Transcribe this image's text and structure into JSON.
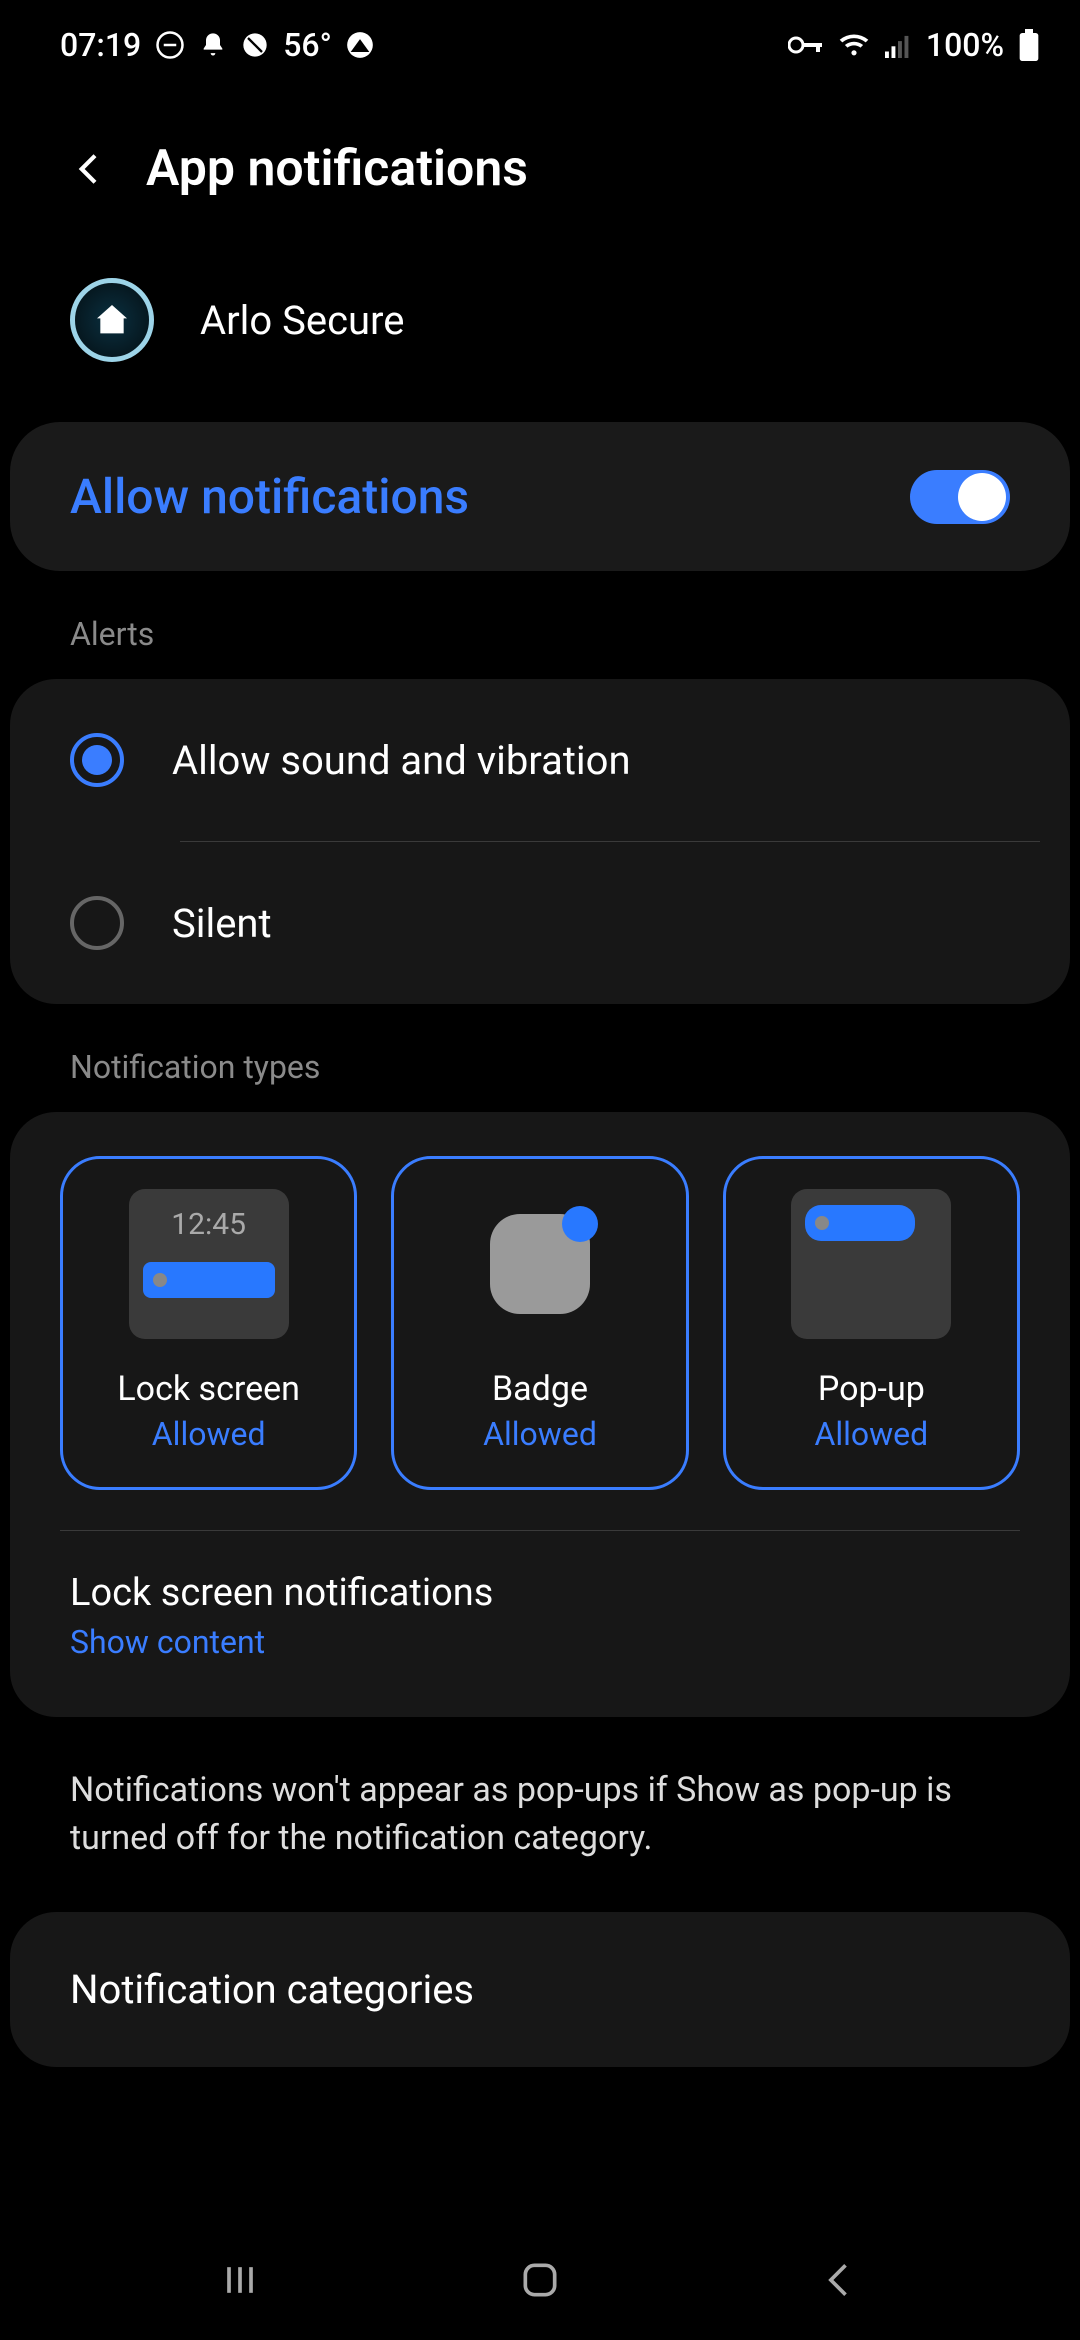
{
  "status": {
    "time": "07:19",
    "temp": "56°",
    "battery": "100%"
  },
  "header": {
    "title": "App notifications"
  },
  "app": {
    "name": "Arlo Secure"
  },
  "allow": {
    "label": "Allow notifications",
    "enabled": true
  },
  "sections": {
    "alerts": "Alerts",
    "types": "Notification types"
  },
  "alerts": {
    "options": [
      {
        "label": "Allow sound and vibration",
        "selected": true
      },
      {
        "label": "Silent",
        "selected": false
      }
    ]
  },
  "types": {
    "lock": {
      "label": "Lock screen",
      "status": "Allowed",
      "preview_time": "12:45"
    },
    "badge": {
      "label": "Badge",
      "status": "Allowed"
    },
    "popup": {
      "label": "Pop-up",
      "status": "Allowed"
    }
  },
  "lock_notif": {
    "title": "Lock screen notifications",
    "sub": "Show content"
  },
  "info": "Notifications won't appear as pop-ups if Show as pop-up is turned off for the notification category.",
  "categories": {
    "label": "Notification categories"
  }
}
